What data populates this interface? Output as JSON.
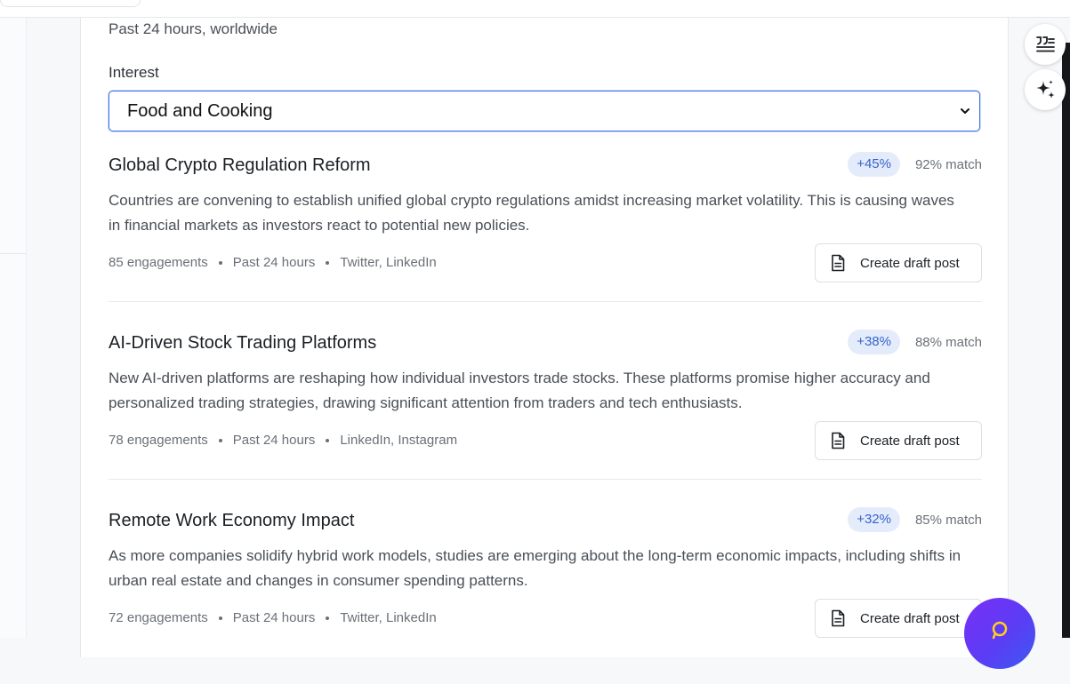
{
  "header": {
    "subtitle": "Past 24 hours, worldwide"
  },
  "filter": {
    "label": "Interest",
    "selected": "Food and Cooking"
  },
  "trends": [
    {
      "title": "Global Crypto Regulation Reform",
      "growth": "+45%",
      "match": "92% match",
      "description": "Countries are convening to establish unified global crypto regulations amidst increasing market volatility. This is causing waves in financial markets as investors react to potential new policies.",
      "engagements": "85 engagements",
      "timeframe": "Past 24 hours",
      "platforms": "Twitter, LinkedIn",
      "action_label": "Create draft post"
    },
    {
      "title": "AI-Driven Stock Trading Platforms",
      "growth": "+38%",
      "match": "88% match",
      "description": "New AI-driven platforms are reshaping how individual investors trade stocks. These platforms promise higher accuracy and personalized trading strategies, drawing significant attention from traders and tech enthusiasts.",
      "engagements": "78 engagements",
      "timeframe": "Past 24 hours",
      "platforms": "LinkedIn, Instagram",
      "action_label": "Create draft post"
    },
    {
      "title": "Remote Work Economy Impact",
      "growth": "+32%",
      "match": "85% match",
      "description": "As more companies solidify hybrid work models, studies are emerging about the long-term economic impacts, including shifts in urban real estate and changes in consumer spending patterns.",
      "engagements": "72 engagements",
      "timeframe": "Past 24 hours",
      "platforms": "Twitter, LinkedIn",
      "action_label": "Create draft post"
    }
  ],
  "floating_tools": {
    "icons": [
      "quote-lines-icon",
      "sparkle-icon",
      "chat-icon"
    ]
  },
  "colors": {
    "accent": "#3b74e0",
    "badge_bg": "#e4ecfb",
    "badge_text": "#3563c9",
    "chat_gradient_start": "#7b2ff7",
    "chat_gradient_end": "#3d5af1"
  }
}
